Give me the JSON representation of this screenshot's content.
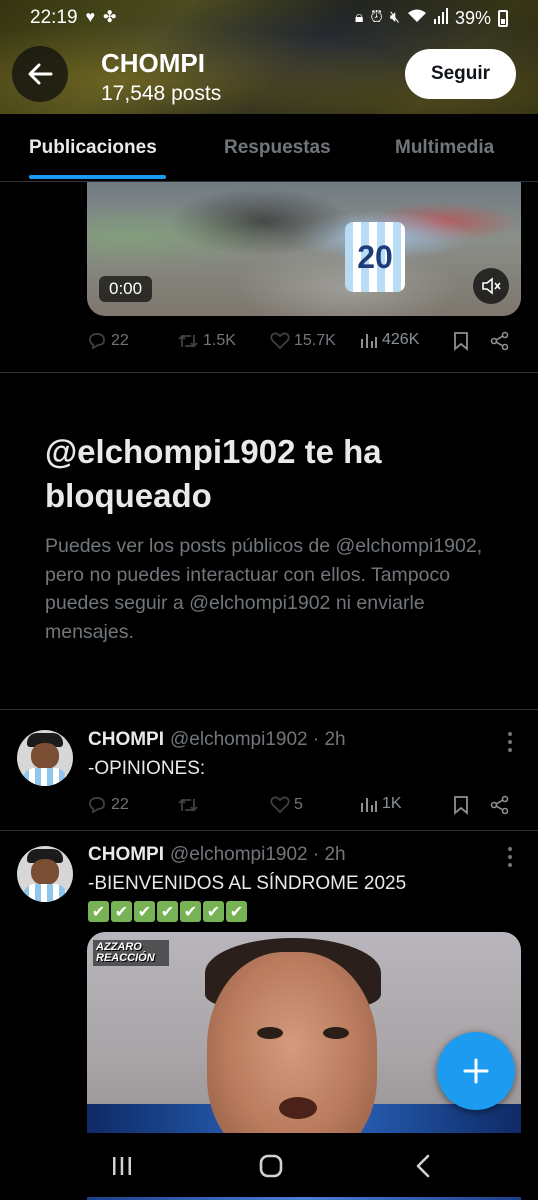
{
  "status_bar": {
    "time": "22:19",
    "battery": "39%",
    "icons": [
      "heart-icon",
      "pinwheel-icon",
      "lock-icon",
      "alarm-icon",
      "mute-icon",
      "wifi-icon",
      "signal-icon",
      "battery-icon"
    ]
  },
  "header": {
    "name": "CHOMPI",
    "post_count": "17,548 posts",
    "follow_label": "Seguir"
  },
  "tabs": [
    {
      "label": "Publicaciones",
      "active": true
    },
    {
      "label": "Respuestas",
      "active": false
    },
    {
      "label": "Multimedia",
      "active": false
    }
  ],
  "video_post": {
    "duration": "0:00",
    "jersey_number": "20",
    "replies": "22",
    "reposts": "1.5K",
    "likes": "15.7K",
    "views": "426K"
  },
  "blocked": {
    "title": "@elchompi1902 te ha bloqueado",
    "description": "Puedes ver los posts públicos de @elchompi1902, pero no puedes interactuar con ellos. Tampoco puedes seguir a @elchompi1902 ni enviarle mensajes."
  },
  "posts": [
    {
      "name": "CHOMPI",
      "handle": "@elchompi1902",
      "time": "· 2h",
      "text": "-OPINIONES:",
      "replies": "22",
      "reposts": "",
      "likes": "5",
      "views": "1K"
    },
    {
      "name": "CHOMPI",
      "handle": "@elchompi1902",
      "time": "· 2h",
      "text": "-BIENVENIDOS AL SÍNDROME 2025",
      "emoji": "✔",
      "emoji_count": 7,
      "media_logo": "AZZARO REACCIÓN"
    }
  ],
  "colors": {
    "accent": "#1d9bf0",
    "background": "#000000",
    "text": "#e7e9ea",
    "muted": "#71767b",
    "border": "#2f3336"
  }
}
